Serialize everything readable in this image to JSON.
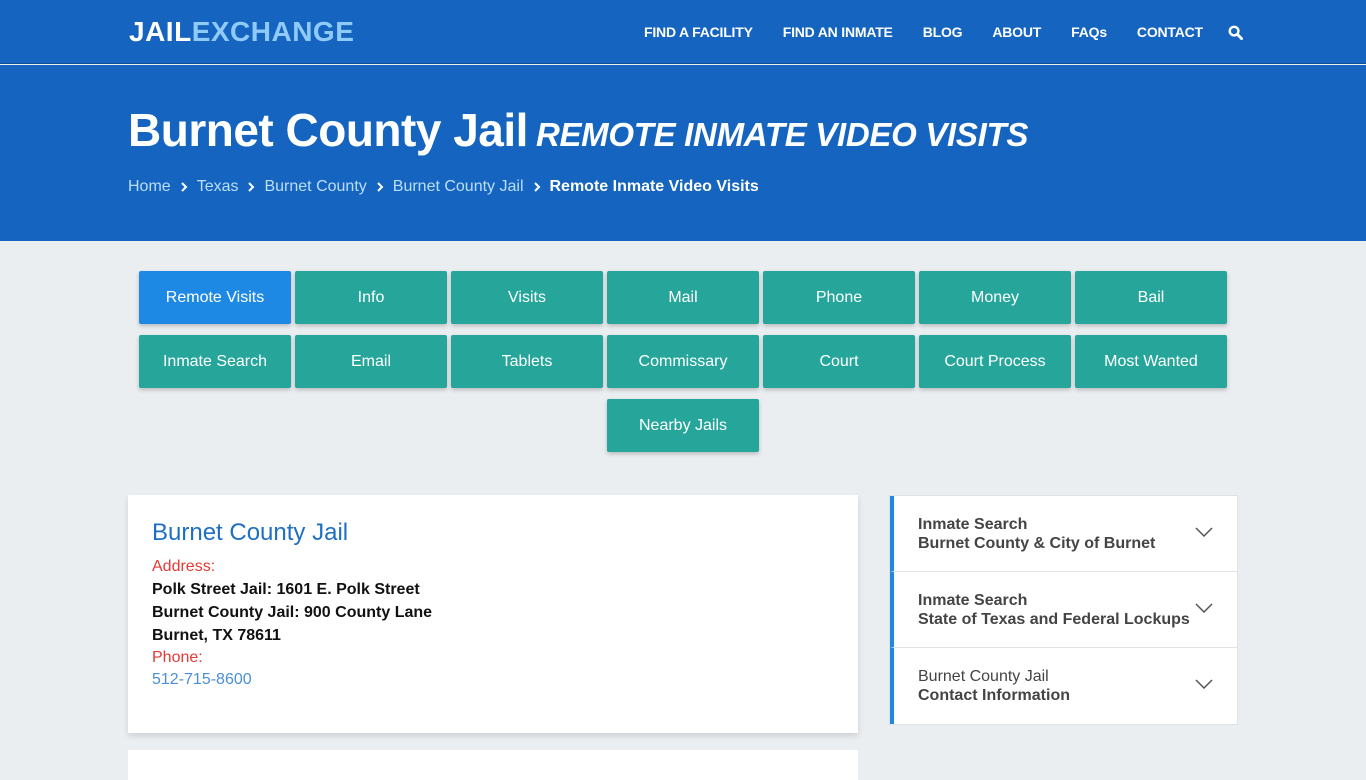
{
  "header": {
    "logo_part1": "JAIL",
    "logo_part2": "EXCHANGE",
    "nav": [
      {
        "label": "FIND A FACILITY"
      },
      {
        "label": "FIND AN INMATE"
      },
      {
        "label": "BLOG"
      },
      {
        "label": "ABOUT"
      },
      {
        "label": "FAQs"
      },
      {
        "label": "CONTACT"
      }
    ],
    "search_icon": "search-icon"
  },
  "hero": {
    "title": "Burnet County Jail",
    "subtitle": "REMOTE INMATE VIDEO VISITS",
    "breadcrumb": [
      {
        "label": "Home"
      },
      {
        "label": "Texas"
      },
      {
        "label": "Burnet County"
      },
      {
        "label": "Burnet County Jail"
      }
    ],
    "breadcrumb_current": "Remote Inmate Video Visits"
  },
  "buttons": [
    {
      "label": "Remote Visits",
      "active": true
    },
    {
      "label": "Info"
    },
    {
      "label": "Visits"
    },
    {
      "label": "Mail"
    },
    {
      "label": "Phone"
    },
    {
      "label": "Money"
    },
    {
      "label": "Bail"
    },
    {
      "label": "Inmate Search"
    },
    {
      "label": "Email"
    },
    {
      "label": "Tablets"
    },
    {
      "label": "Commissary"
    },
    {
      "label": "Court"
    },
    {
      "label": "Court Process"
    },
    {
      "label": "Most Wanted"
    },
    {
      "label": "Nearby Jails"
    }
  ],
  "facility": {
    "name": "Burnet County Jail",
    "address_label": "Address:",
    "address_lines": [
      "Polk Street Jail: 1601 E. Polk Street",
      "Burnet County Jail: 900 County Lane",
      "Burnet, TX 78611"
    ],
    "phone_label": "Phone:",
    "phone": "512-715-8600"
  },
  "sidebar": {
    "items": [
      {
        "line1": "Inmate Search",
        "line2": "Burnet County & City of Burnet"
      },
      {
        "line1": "Inmate Search",
        "line2": "State of Texas and Federal Lockups"
      },
      {
        "line1": "Burnet County Jail",
        "line2": "Contact Information"
      }
    ]
  },
  "colors": {
    "brand_blue": "#1565c0",
    "logo_accent": "#90caf9",
    "button_teal": "#26a69a",
    "button_active": "#1e88e5",
    "label_red": "#e53935",
    "link_blue": "#1e6fc4"
  }
}
